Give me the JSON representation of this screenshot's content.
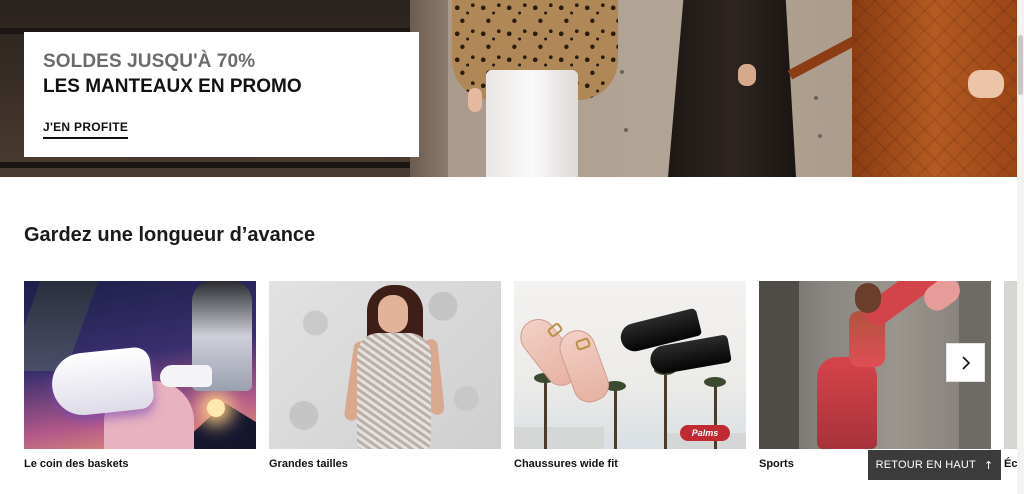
{
  "hero": {
    "promo_line1": "SOLDES JUSQU'À 70%",
    "promo_line2": "LES MANTEAUX EN PROMO",
    "cta_label": "J'EN PROFITE"
  },
  "section": {
    "title": "Gardez une longueur d’avance"
  },
  "carousel": {
    "items": [
      {
        "label": "Le coin des baskets"
      },
      {
        "label": "Grandes tailles"
      },
      {
        "label": "Chaussures wide fit"
      },
      {
        "label": "Sports"
      },
      {
        "label": "Éc"
      }
    ],
    "next_icon": "chevron-right-icon"
  },
  "widefit_sign": "Palms",
  "back_to_top": {
    "label": "RETOUR EN HAUT",
    "icon": "↑"
  },
  "colors": {
    "back_to_top_bg": "#3b3b3b",
    "text_dark": "#111111",
    "promo_grey": "#6b6b6b"
  }
}
